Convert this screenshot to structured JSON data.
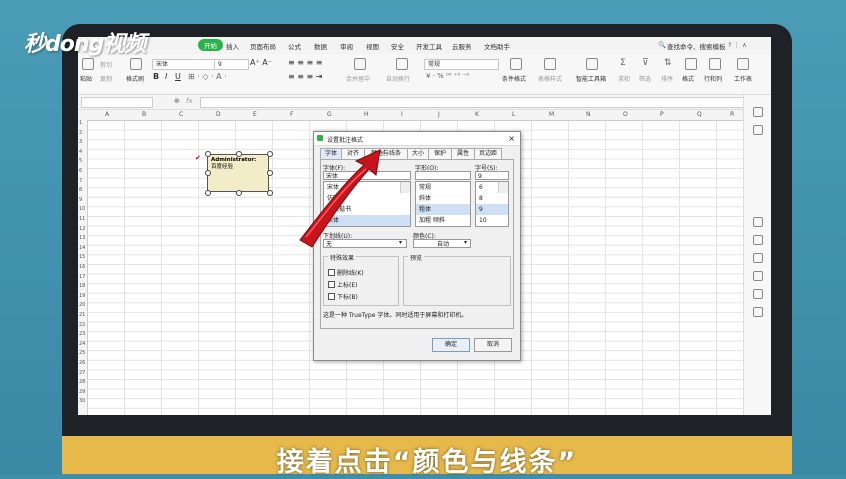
{
  "brand": {
    "logo_text": "秒dong视频"
  },
  "caption": "接着点击“颜色与线条”",
  "menu": {
    "start_tab": "开始",
    "items": [
      "插入",
      "页面布局",
      "公式",
      "数据",
      "审阅",
      "视图",
      "安全",
      "开发工具",
      "云服务",
      "文档助手"
    ],
    "search": "查找命令、搜索模板"
  },
  "ribbon": {
    "cut": "剪切",
    "copy": "复制",
    "paste": "粘贴",
    "format_painter": "格式刷",
    "font_name": "宋体",
    "font_size": "9",
    "number_format": "常规",
    "merge": "合并居中",
    "wrap": "自动换行",
    "conditional_format": "条件格式",
    "table_style": "表格样式",
    "smart_toolbox": "智能工具箱",
    "sum": "求和",
    "filter": "筛选",
    "sort": "排序",
    "format": "格式",
    "row_col": "行和列",
    "worksheet": "工作表"
  },
  "columns": [
    "A",
    "B",
    "C",
    "D",
    "E",
    "F",
    "G",
    "H",
    "I",
    "J",
    "K",
    "L",
    "M",
    "N",
    "O",
    "P",
    "Q",
    "R"
  ],
  "rows": [
    "1",
    "2",
    "3",
    "4",
    "5",
    "6",
    "7",
    "8",
    "9",
    "10",
    "11",
    "12",
    "13",
    "14",
    "15",
    "16",
    "17",
    "18",
    "19",
    "20",
    "21",
    "22",
    "23",
    "24",
    "25",
    "26",
    "27",
    "28",
    "29",
    "30"
  ],
  "comment": {
    "author": "Administrator:",
    "text": "百度经验"
  },
  "dialog": {
    "title": "设置批注格式",
    "tabs": [
      "字体",
      "对齐",
      "颜色与线条",
      "大小",
      "保护",
      "属性",
      "页边距"
    ],
    "font_label": "字体(F):",
    "font_value": "宋体",
    "style_label": "字形(O):",
    "size_label": "字号(S):",
    "size_value": "9",
    "font_list": [
      "宋体",
      "仿宋",
      "华文楷书",
      "宋体"
    ],
    "style_list": [
      "常规",
      "斜体",
      "粗体",
      "加粗 倾斜"
    ],
    "size_list": [
      "6",
      "8",
      "9",
      "10"
    ],
    "underline_label": "下划线(U):",
    "underline_value": "无",
    "color_label": "颜色(C):",
    "color_value": "自动",
    "effects_label": "特殊效果",
    "effects": [
      "删除线(K)",
      "上标(E)",
      "下标(B)"
    ],
    "preview_label": "预览",
    "note": "这是一种 TrueType 字体。同时适用于屏幕和打印机。",
    "ok": "确定",
    "cancel": "取消"
  }
}
